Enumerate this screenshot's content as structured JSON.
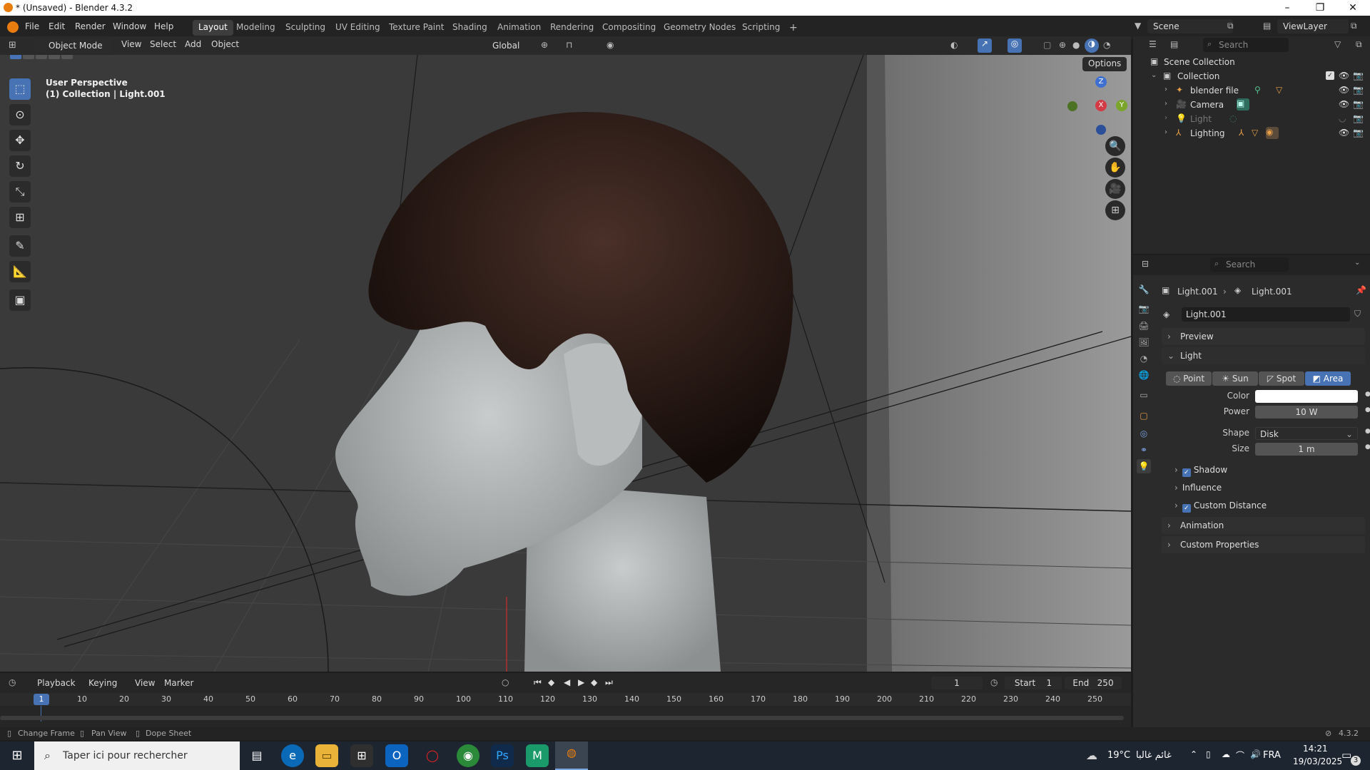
{
  "window": {
    "title": "* (Unsaved) - Blender 4.3.2"
  },
  "menu": [
    "File",
    "Edit",
    "Render",
    "Window",
    "Help"
  ],
  "workspaces": [
    "Layout",
    "Modeling",
    "Sculpting",
    "UV Editing",
    "Texture Paint",
    "Shading",
    "Animation",
    "Rendering",
    "Compositing",
    "Geometry Nodes",
    "Scripting"
  ],
  "scene": {
    "label": "Scene",
    "view_layer": "ViewLayer"
  },
  "viewport_header": {
    "mode": "Object Mode",
    "items": [
      "View",
      "Select",
      "Add",
      "Object"
    ],
    "orientation": "Global",
    "options": "Options"
  },
  "viewport": {
    "perspective": "User Perspective",
    "context": "(1) Collection | Light.001",
    "gizmo": {
      "z": "Z",
      "x": "X",
      "y": "Y"
    }
  },
  "outliner": {
    "search_placeholder": "Search",
    "scene_collection": "Scene Collection",
    "collection": "Collection",
    "items": [
      "blender file",
      "Camera",
      "Light",
      "Lighting"
    ]
  },
  "properties": {
    "search_placeholder": "Search",
    "breadcrumb": [
      "Light.001",
      "Light.001"
    ],
    "datablock": "Light.001",
    "preview": "Preview",
    "light_section": "Light",
    "light_types": [
      "Point",
      "Sun",
      "Spot",
      "Area"
    ],
    "active_type": "Area",
    "color_label": "Color",
    "color_value": "#ffffff",
    "power_label": "Power",
    "power_value": "10 W",
    "shape_label": "Shape",
    "shape_value": "Disk",
    "size_label": "Size",
    "size_value": "1 m",
    "subpanels": [
      "Shadow",
      "Influence",
      "Custom Distance"
    ],
    "animation": "Animation",
    "custom_properties": "Custom Properties"
  },
  "timeline": {
    "menus": [
      "Playback",
      "Keying",
      "View",
      "Marker"
    ],
    "current_frame": "1",
    "start_label": "Start",
    "start": "1",
    "end_label": "End",
    "end": "250",
    "ticks": [
      "10",
      "20",
      "30",
      "40",
      "50",
      "60",
      "70",
      "80",
      "90",
      "100",
      "110",
      "120",
      "130",
      "140",
      "150",
      "160",
      "170",
      "180",
      "190",
      "200",
      "210",
      "220",
      "230",
      "240",
      "250"
    ]
  },
  "statusbar": {
    "items": [
      "Change Frame",
      "Pan View",
      "Dope Sheet"
    ],
    "version": "4.3.2"
  },
  "taskbar": {
    "search_placeholder": "Taper ici pour rechercher",
    "weather": "19°C",
    "weather_desc": "غائم غالبا",
    "lang": "FRA",
    "time": "14:21",
    "date": "19/03/2025",
    "notifications": "3"
  }
}
